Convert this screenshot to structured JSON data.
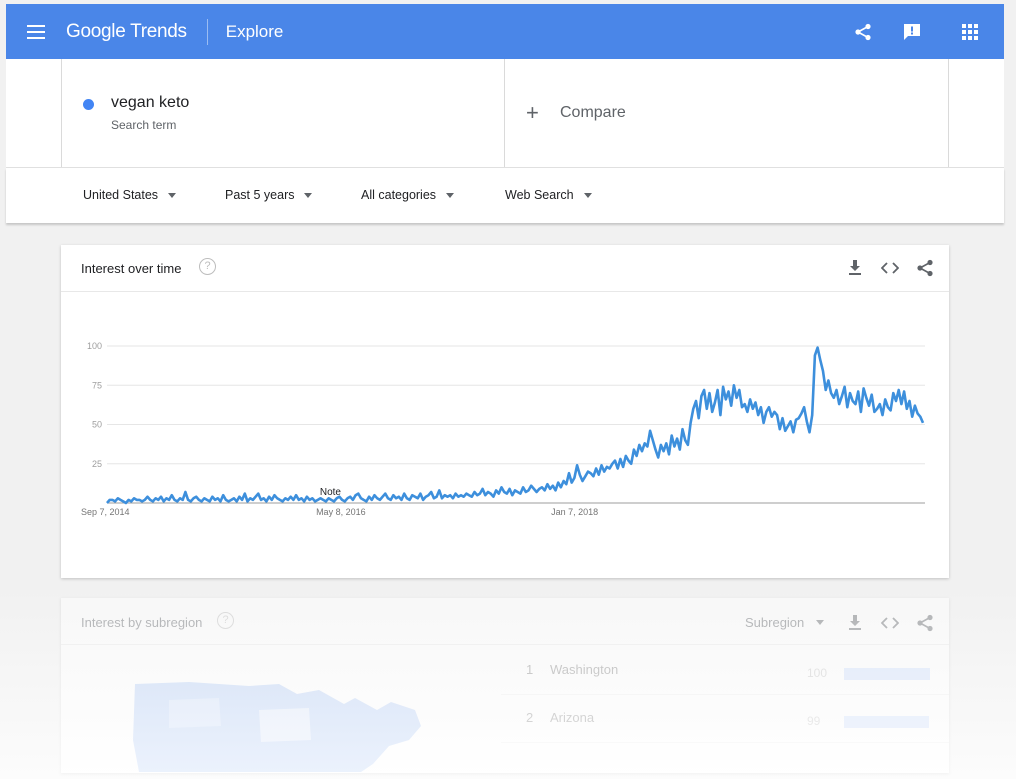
{
  "header": {
    "logo_text": "Google Trends",
    "section": "Explore",
    "accent_color": "#4a86e8",
    "icons": [
      "menu-icon",
      "share-icon",
      "feedback-icon",
      "apps-grid-icon"
    ]
  },
  "search": {
    "term": "vegan keto",
    "term_type": "Search term",
    "term_color": "#4285f4",
    "compare_label": "Compare"
  },
  "filters": {
    "region": "United States",
    "time_range": "Past 5 years",
    "category": "All categories",
    "property": "Web Search"
  },
  "interest_over_time": {
    "title": "Interest over time",
    "help": "?",
    "note_label": "Note"
  },
  "chart_data": {
    "type": "line",
    "title": "",
    "xlabel": "",
    "ylabel": "",
    "ylim": [
      0,
      100
    ],
    "yticks": [
      "100",
      "75",
      "50",
      "25"
    ],
    "xtick_labels": [
      "Sep 7, 2014",
      "May 8, 2016",
      "Jan 7, 2018"
    ],
    "xtick_index": [
      0,
      87,
      174
    ],
    "grid": true,
    "line_color": "#3d8fdc",
    "series": [
      {
        "name": "vegan keto",
        "values": [
          0,
          2,
          2,
          1,
          3,
          2,
          1,
          0,
          2,
          1,
          3,
          2,
          2,
          1,
          2,
          4,
          2,
          1,
          3,
          2,
          4,
          1,
          3,
          2,
          5,
          2,
          1,
          3,
          2,
          7,
          2,
          1,
          3,
          4,
          2,
          1,
          3,
          2,
          1,
          4,
          2,
          3,
          1,
          5,
          2,
          1,
          2,
          3,
          1,
          4,
          2,
          6,
          1,
          3,
          2,
          4,
          6,
          2,
          3,
          1,
          4,
          2,
          5,
          3,
          2,
          1,
          3,
          2,
          4,
          2,
          5,
          2,
          3,
          1,
          4,
          2,
          3,
          1,
          2,
          3,
          2,
          1,
          3,
          2,
          1,
          3,
          4,
          2,
          1,
          3,
          4,
          2,
          5,
          6,
          3,
          2,
          1,
          4,
          2,
          5,
          3,
          2,
          4,
          6,
          3,
          2,
          5,
          3,
          4,
          2,
          6,
          3,
          2,
          5,
          4,
          3,
          6,
          2,
          4,
          5,
          7,
          3,
          4,
          8,
          3,
          5,
          4,
          5,
          3,
          6,
          4,
          5,
          4,
          6,
          5,
          4,
          7,
          5,
          6,
          9,
          5,
          7,
          6,
          4,
          8,
          6,
          10,
          7,
          6,
          9,
          5,
          8,
          7,
          6,
          10,
          7,
          8,
          11,
          9,
          7,
          9,
          10,
          8,
          12,
          9,
          11,
          8,
          13,
          10,
          14,
          12,
          19,
          13,
          16,
          24,
          18,
          14,
          17,
          20,
          19,
          17,
          22,
          18,
          24,
          20,
          23,
          22,
          25,
          27,
          22,
          28,
          23,
          30,
          27,
          25,
          34,
          30,
          37,
          33,
          38,
          36,
          46,
          40,
          34,
          29,
          37,
          33,
          38,
          31,
          43,
          36,
          41,
          34,
          47,
          40,
          37,
          51,
          60,
          65,
          54,
          68,
          72,
          60,
          70,
          58,
          64,
          72,
          56,
          74,
          66,
          71,
          62,
          75,
          67,
          72,
          61,
          63,
          58,
          66,
          60,
          64,
          56,
          61,
          51,
          58,
          61,
          55,
          58,
          56,
          47,
          54,
          46,
          49,
          52,
          45,
          53,
          54,
          57,
          61,
          52,
          45,
          56,
          94,
          99,
          91,
          84,
          72,
          78,
          70,
          67,
          72,
          63,
          68,
          74,
          61,
          70,
          65,
          63,
          71,
          58,
          73,
          67,
          62,
          69,
          58,
          60,
          63,
          56,
          66,
          61,
          59,
          70,
          65,
          72,
          63,
          71,
          60,
          65,
          55,
          62,
          57,
          55,
          51
        ]
      }
    ]
  },
  "subregion": {
    "title": "Interest by subregion",
    "help": "?",
    "select_value": "Subregion",
    "rows": [
      {
        "rank": "1",
        "name": "Washington",
        "value": "100",
        "level": 1.0
      },
      {
        "rank": "2",
        "name": "Arizona",
        "value": "99",
        "level": 0.99
      }
    ]
  }
}
